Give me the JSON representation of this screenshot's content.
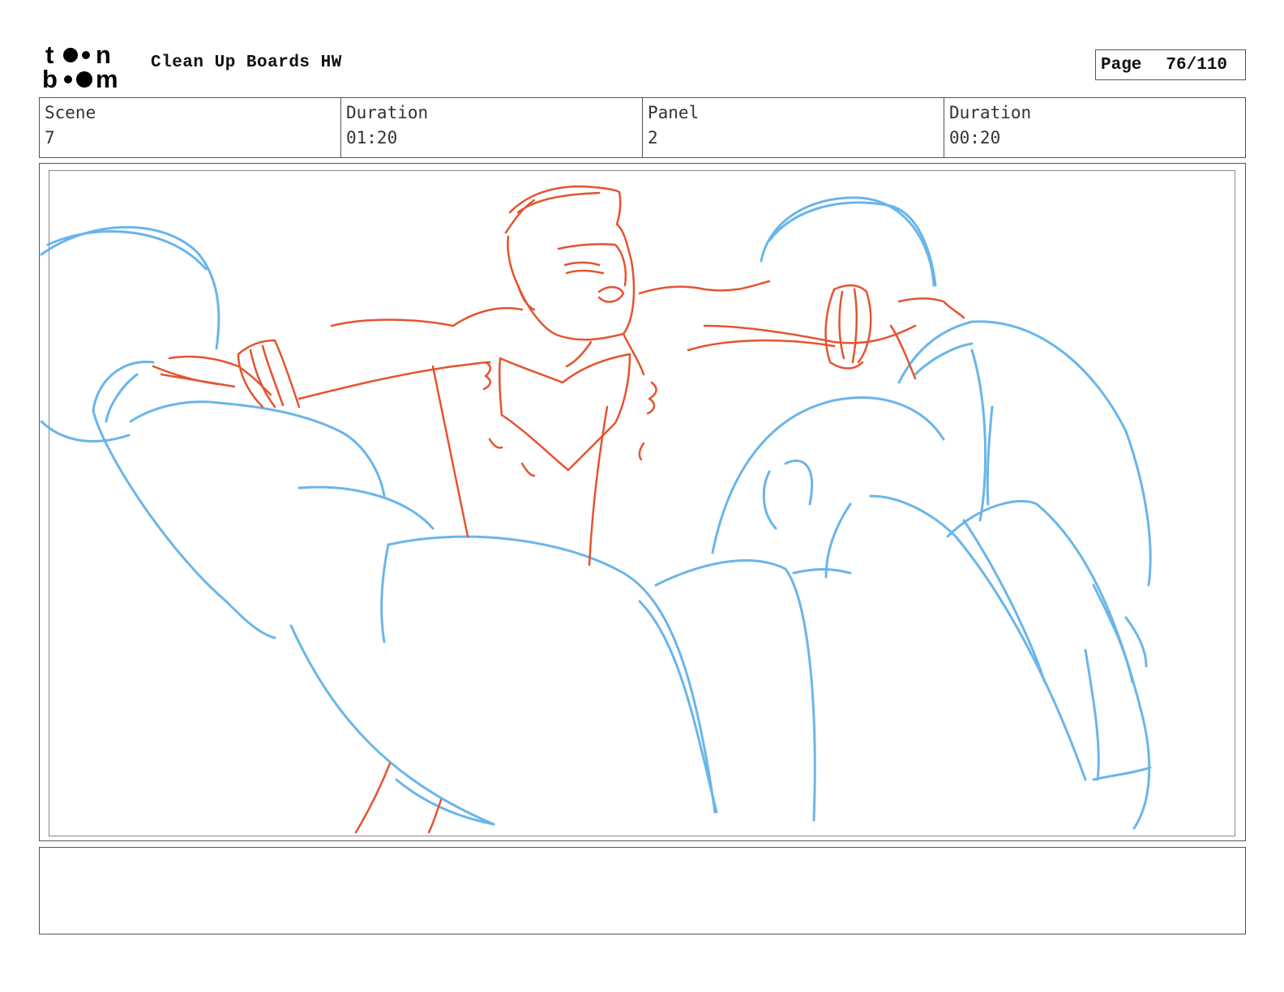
{
  "header": {
    "logo_text": "toon boom",
    "title": "Clean Up Boards HW",
    "page_label": "Page",
    "page_value": "76/110"
  },
  "info": {
    "scene_label": "Scene",
    "scene_value": "7",
    "scene_duration_label": "Duration",
    "scene_duration_value": "01:20",
    "panel_label": "Panel",
    "panel_value": "2",
    "panel_duration_label": "Duration",
    "panel_duration_value": "00:20"
  },
  "colors": {
    "sketch_blue": "#5aaee8",
    "sketch_red": "#e4542f"
  },
  "notes": {
    "text": ""
  }
}
